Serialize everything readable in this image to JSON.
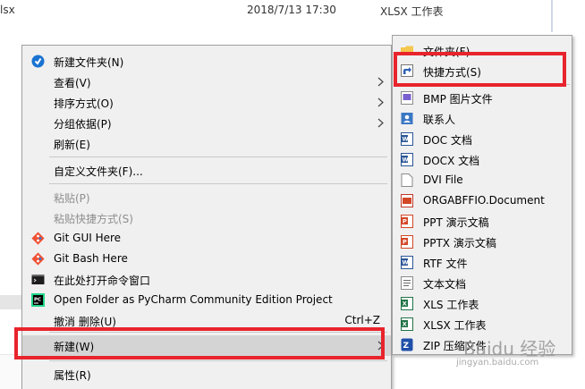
{
  "file_row": {
    "name": "lsx",
    "modified": "2018/7/13 17:30",
    "type": "XLSX 工作表"
  },
  "context_menu": {
    "new_folder": "新建文件夹(N)",
    "view": "查看(V)",
    "sort_by": "排序方式(O)",
    "group_by": "分组依据(P)",
    "refresh": "刷新(E)",
    "customize_folder": "自定义文件夹(F)...",
    "paste": "粘贴(P)",
    "paste_shortcut": "粘贴快捷方式(S)",
    "git_gui": "Git GUI Here",
    "git_bash": "Git Bash Here",
    "open_cmd": "在此处打开命令窗口",
    "pycharm": "Open Folder as PyCharm Community Edition Project",
    "undo_delete": "撤消 删除(U)",
    "undo_shortcut": "Ctrl+Z",
    "new": "新建(W)",
    "properties": "属性(R)"
  },
  "new_submenu": {
    "folder": "文件夹(F)",
    "shortcut": "快捷方式(S)",
    "items": [
      "BMP 图片文件",
      "联系人",
      "DOC 文档",
      "DOCX 文档",
      "DVI File",
      "ORGABFFIO.Document",
      "PPT 演示文稿",
      "PPTX 演示文稿",
      "RTF 文件",
      "文本文档",
      "XLS 工作表",
      "XLSX 工作表",
      "ZIP 压缩文件"
    ]
  },
  "watermark": {
    "main": "Baidu 经验",
    "sub": "jingyan.baidu.com"
  },
  "colors": {
    "highlight_box": "#e8242c",
    "menu_bg": "#f0f0f0"
  }
}
